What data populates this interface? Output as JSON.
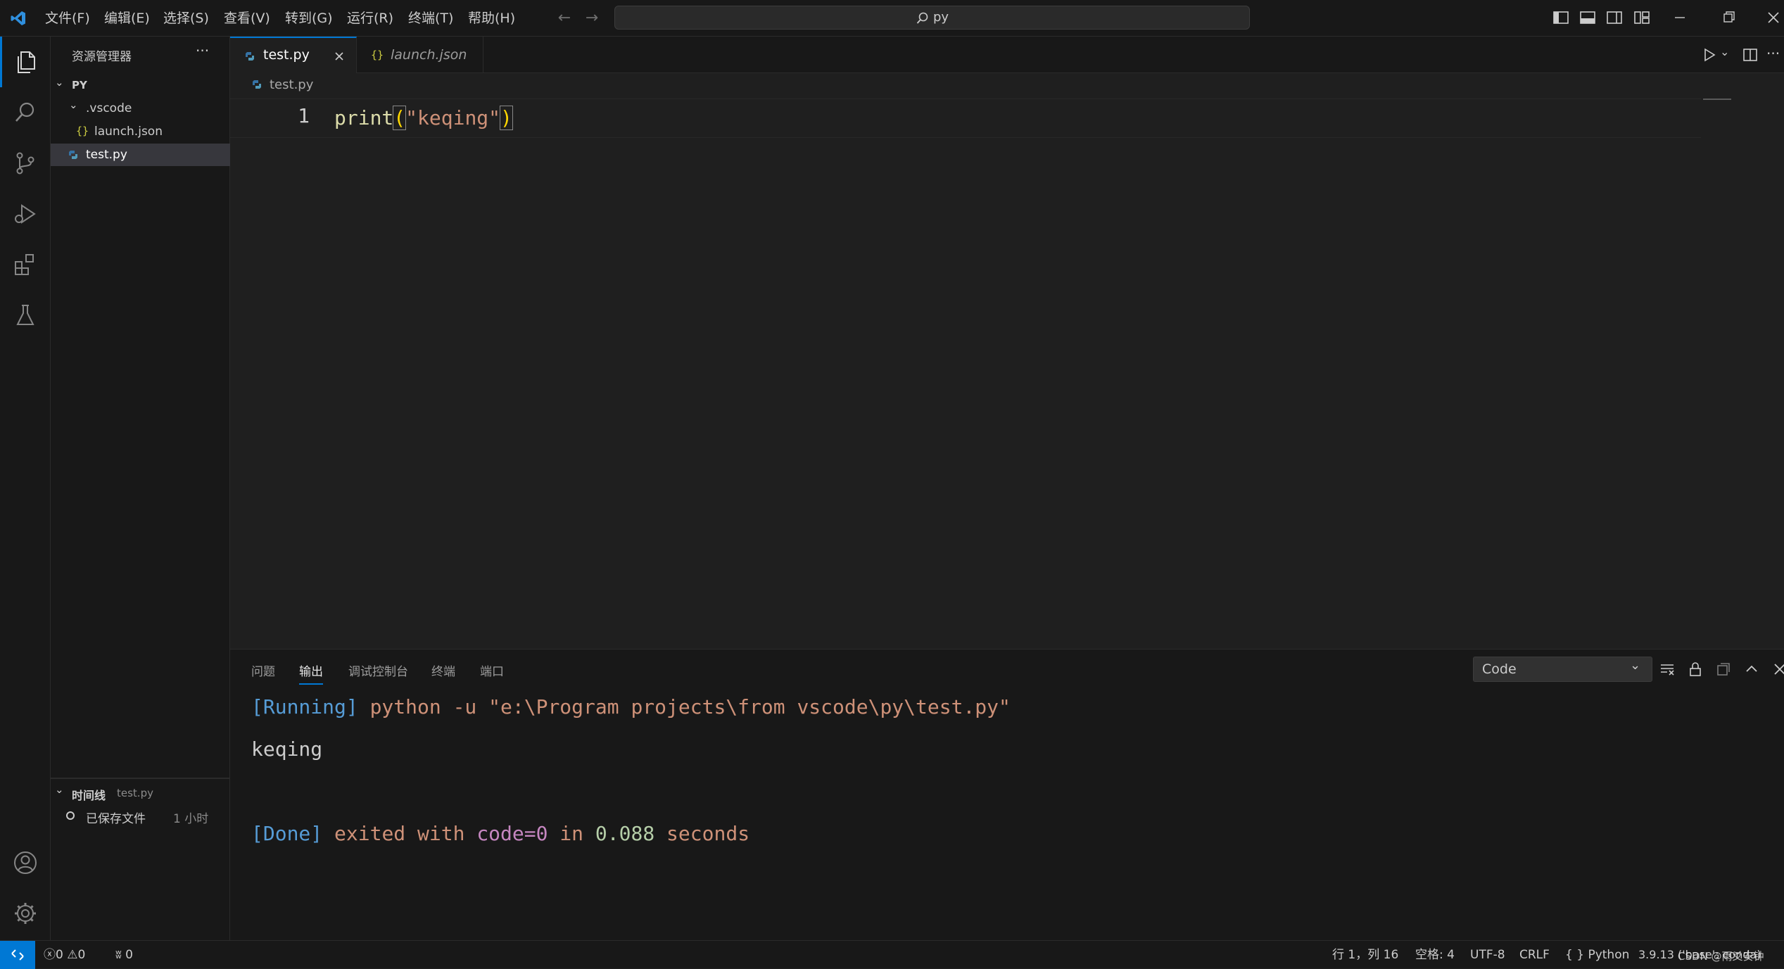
{
  "menu": [
    "文件(F)",
    "编辑(E)",
    "选择(S)",
    "查看(V)",
    "转到(G)",
    "运行(R)",
    "终端(T)",
    "帮助(H)"
  ],
  "search": {
    "text": "py"
  },
  "sidebar": {
    "title": "资源管理器",
    "root": "PY",
    "items": [
      ".vscode",
      "launch.json",
      "test.py"
    ],
    "timeline_title": "时间线",
    "timeline_file": "test.py",
    "timeline_entry": "已保存文件",
    "timeline_time": "1 小时"
  },
  "tabs": [
    {
      "label": "test.py"
    },
    {
      "label": "launch.json"
    }
  ],
  "breadcrumb": "test.py",
  "code": {
    "line_number": "1",
    "fn": "print",
    "open": "(",
    "str": "\"keqing\"",
    "close": ")"
  },
  "panel": {
    "tabs": [
      "问题",
      "输出",
      "调试控制台",
      "终端",
      "端口"
    ],
    "channel": "Code",
    "run_tag": "[Running]",
    "run_cmd": " python -u \"e:\\Program projects\\from vscode\\py\\test.py\"",
    "output_line": "keqing",
    "done_tag": "[Done]",
    "done_1": " exited with ",
    "done_code": "code=0",
    "done_2": " in ",
    "done_time": "0.088",
    "done_3": " seconds"
  },
  "status": {
    "errors": "0",
    "warnings": "0",
    "ports": "0",
    "position": "行 1，列 16",
    "spaces": "空格: 4",
    "encoding": "UTF-8",
    "eol": "CRLF",
    "language": "Python",
    "interpreter": "3.9.13 ('base': conda)",
    "watermark": "CSDN @雨爻安钟"
  },
  "colors": {
    "accent": "#0078d4",
    "string": "#ce9178",
    "fn": "#dcdcaa",
    "bracket": "#ffd700",
    "done": "#569cd6",
    "number": "#b5cea8",
    "code": "#c586c0"
  }
}
